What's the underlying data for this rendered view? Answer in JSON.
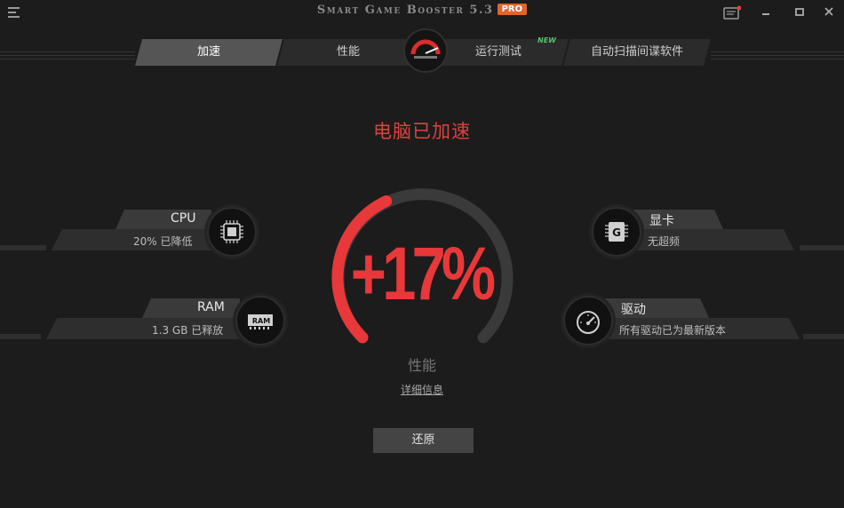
{
  "app": {
    "title": "Smart Game Booster 5.3",
    "badge": "PRO"
  },
  "window_controls": [
    "notification-icon",
    "minimize-icon",
    "maximize-icon",
    "close-icon"
  ],
  "tabs": [
    {
      "label": "加速",
      "active": true
    },
    {
      "label": "性能",
      "active": false
    },
    {
      "label": "运行测试",
      "active": false,
      "tag": "NEW"
    },
    {
      "label": "自动扫描间谍软件",
      "active": false
    }
  ],
  "headline": "电脑已加速",
  "gauge": {
    "value_text": "+17%",
    "value": 17,
    "label": "性能",
    "details_link": "详细信息"
  },
  "cpu": {
    "title": "CPU",
    "status": "20% 已降低",
    "icon": "cpu-chip-icon"
  },
  "ram": {
    "title": "RAM",
    "status": "1.3 GB 已释放",
    "icon": "ram-icon",
    "icon_text": "RAM"
  },
  "gpu": {
    "title": "显卡",
    "status": "无超频",
    "icon": "gpu-icon",
    "icon_text": "G"
  },
  "driver": {
    "title": "驱动",
    "status": "所有驱动已为最新版本",
    "icon": "speedometer-icon"
  },
  "restore_button": "还原",
  "colors": {
    "accent": "#e8383a",
    "background": "#1c1c1c",
    "pro_badge": "#e0652a",
    "new_tag": "#55c06a"
  }
}
